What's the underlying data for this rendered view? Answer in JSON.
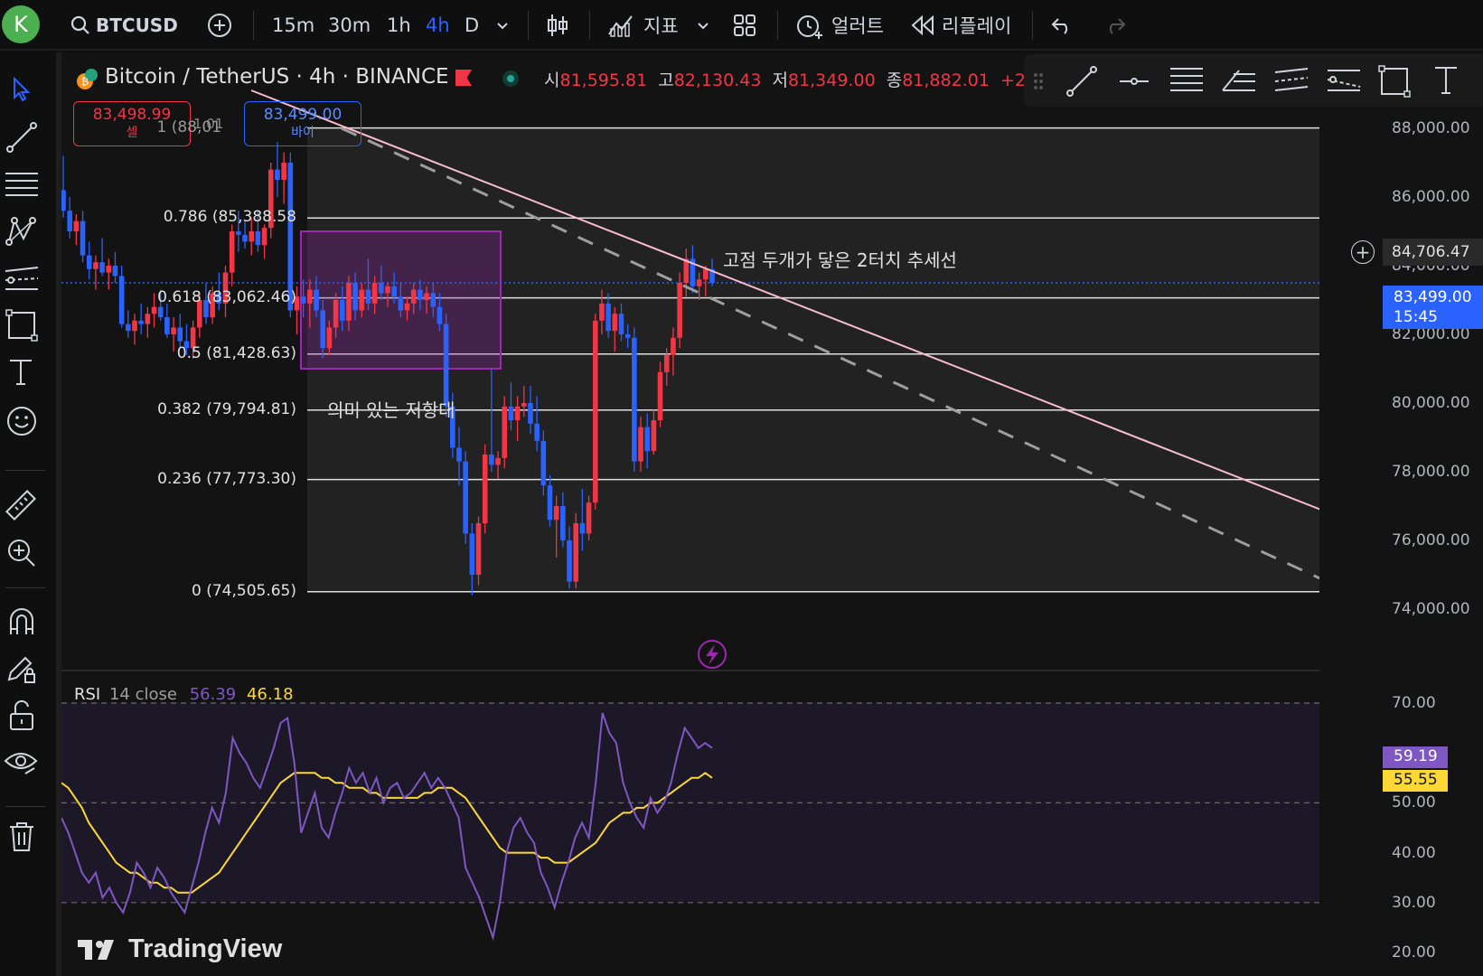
{
  "topbar": {
    "avatar": "K",
    "symbol": "BTCUSD",
    "timeframes": [
      "15m",
      "30m",
      "1h",
      "4h",
      "D"
    ],
    "active_timeframe": "4h",
    "indicators_label": "지표",
    "alert_label": "얼러트",
    "replay_label": "리플레이"
  },
  "legend": {
    "title": "Bitcoin / TetherUS · 4h · BINANCE",
    "open_label": "시",
    "open": "81,595.81",
    "high_label": "고",
    "high": "82,130.43",
    "low_label": "저",
    "low": "81,349.00",
    "close_label": "종",
    "close": "81,882.01",
    "change": "+2"
  },
  "trade": {
    "sell_price": "83,498.99",
    "sell_label": "셀",
    "buy_price": "83,499.00",
    "buy_label": "바이",
    "spread": "1.01"
  },
  "price_axis": {
    "ticks": [
      "88,000.00",
      "86,000.00",
      "84,000.00",
      "82,000.00",
      "80,000.00",
      "78,000.00",
      "76,000.00",
      "74,000.00"
    ],
    "crosshair_price": "84,706.47",
    "current_price": "83,499.00",
    "countdown": "15:45"
  },
  "fib_levels": [
    {
      "label": "1 (88,01",
      "value": 88010
    },
    {
      "label": "0.786 (85,388.58",
      "value": 85388.58
    },
    {
      "label": "0.618 (83,062.46)",
      "value": 83062.46
    },
    {
      "label": "0.5 (81,428.63)",
      "value": 81428.63
    },
    {
      "label": "0.382 (79,794.81)",
      "value": 79794.81
    },
    {
      "label": "0.236 (77,773.30)",
      "value": 77773.3
    },
    {
      "label": "0 (74,505.65)",
      "value": 74505.65
    }
  ],
  "annotations": {
    "resistance": "의미 있는 저항대",
    "trendline": "고점 두개가 닿은 2터치 추세선"
  },
  "rsi": {
    "name": "RSI",
    "params": "14 close",
    "rsi_value": "56.39",
    "ma_value": "46.18",
    "axis_ticks": [
      "70.00",
      "50.00",
      "40.00",
      "30.00",
      "20.00"
    ],
    "rsi_last": "59.19",
    "ma_last": "55.55"
  },
  "branding": "TradingView",
  "colors": {
    "up": "#f23645",
    "down": "#2962ff",
    "rsi_line": "#7e57c2",
    "rsi_ma": "#fdd835",
    "zone": "#9c27b0",
    "trendline": "#f8bbd0",
    "accent": "#2962ff"
  },
  "chart_data": {
    "type": "candlestick",
    "ylim": [
      74000,
      88600
    ],
    "candles": [
      {
        "o": 86200,
        "h": 87200,
        "l": 85400,
        "c": 85600
      },
      {
        "o": 85600,
        "h": 86000,
        "l": 84800,
        "c": 85000
      },
      {
        "o": 85000,
        "h": 85500,
        "l": 84600,
        "c": 85300
      },
      {
        "o": 85300,
        "h": 85600,
        "l": 84100,
        "c": 84300
      },
      {
        "o": 84300,
        "h": 84700,
        "l": 83600,
        "c": 83900
      },
      {
        "o": 83900,
        "h": 84300,
        "l": 83300,
        "c": 84100
      },
      {
        "o": 84100,
        "h": 84800,
        "l": 83700,
        "c": 83800
      },
      {
        "o": 83800,
        "h": 84200,
        "l": 83300,
        "c": 84000
      },
      {
        "o": 84000,
        "h": 84400,
        "l": 83500,
        "c": 83700
      },
      {
        "o": 83700,
        "h": 84000,
        "l": 82200,
        "c": 82300
      },
      {
        "o": 82300,
        "h": 82700,
        "l": 81900,
        "c": 82100
      },
      {
        "o": 82100,
        "h": 82600,
        "l": 81700,
        "c": 82400
      },
      {
        "o": 82400,
        "h": 82900,
        "l": 82000,
        "c": 82300
      },
      {
        "o": 82300,
        "h": 82800,
        "l": 81900,
        "c": 82600
      },
      {
        "o": 82600,
        "h": 83200,
        "l": 82200,
        "c": 82800
      },
      {
        "o": 82800,
        "h": 83300,
        "l": 82400,
        "c": 82500
      },
      {
        "o": 82500,
        "h": 82900,
        "l": 81900,
        "c": 82000
      },
      {
        "o": 82000,
        "h": 82500,
        "l": 81500,
        "c": 82200
      },
      {
        "o": 82200,
        "h": 82600,
        "l": 81600,
        "c": 81800
      },
      {
        "o": 81800,
        "h": 82300,
        "l": 81400,
        "c": 81600
      },
      {
        "o": 81600,
        "h": 82400,
        "l": 81300,
        "c": 82200
      },
      {
        "o": 82200,
        "h": 83200,
        "l": 81900,
        "c": 83000
      },
      {
        "o": 83000,
        "h": 83500,
        "l": 82300,
        "c": 82500
      },
      {
        "o": 82500,
        "h": 83400,
        "l": 82300,
        "c": 83200
      },
      {
        "o": 83200,
        "h": 83800,
        "l": 82700,
        "c": 82900
      },
      {
        "o": 82900,
        "h": 84000,
        "l": 82500,
        "c": 83800
      },
      {
        "o": 83800,
        "h": 85200,
        "l": 83400,
        "c": 85000
      },
      {
        "o": 85000,
        "h": 85600,
        "l": 84400,
        "c": 84900
      },
      {
        "o": 84900,
        "h": 85300,
        "l": 84500,
        "c": 84700
      },
      {
        "o": 84700,
        "h": 85400,
        "l": 84300,
        "c": 85000
      },
      {
        "o": 85000,
        "h": 85600,
        "l": 84400,
        "c": 84600
      },
      {
        "o": 84600,
        "h": 85200,
        "l": 84200,
        "c": 85100
      },
      {
        "o": 85100,
        "h": 87000,
        "l": 84800,
        "c": 86800
      },
      {
        "o": 86800,
        "h": 87600,
        "l": 86000,
        "c": 86500
      },
      {
        "o": 86500,
        "h": 87300,
        "l": 85800,
        "c": 87000
      },
      {
        "o": 87000,
        "h": 87300,
        "l": 82500,
        "c": 82700
      },
      {
        "o": 82700,
        "h": 83400,
        "l": 82000,
        "c": 83100
      },
      {
        "o": 83100,
        "h": 83600,
        "l": 82500,
        "c": 82900
      },
      {
        "o": 82900,
        "h": 83600,
        "l": 82200,
        "c": 83300
      },
      {
        "o": 83300,
        "h": 83700,
        "l": 82500,
        "c": 82700
      },
      {
        "o": 82700,
        "h": 83000,
        "l": 81300,
        "c": 81600
      },
      {
        "o": 81600,
        "h": 82400,
        "l": 81400,
        "c": 82200
      },
      {
        "o": 82200,
        "h": 83200,
        "l": 81900,
        "c": 83000
      },
      {
        "o": 83000,
        "h": 83400,
        "l": 82100,
        "c": 82400
      },
      {
        "o": 82400,
        "h": 83700,
        "l": 82100,
        "c": 83500
      },
      {
        "o": 83500,
        "h": 83800,
        "l": 82400,
        "c": 82700
      },
      {
        "o": 82700,
        "h": 83500,
        "l": 82500,
        "c": 83300
      },
      {
        "o": 83300,
        "h": 84200,
        "l": 82700,
        "c": 82900
      },
      {
        "o": 82900,
        "h": 83700,
        "l": 82600,
        "c": 83500
      },
      {
        "o": 83500,
        "h": 84000,
        "l": 83000,
        "c": 83200
      },
      {
        "o": 83200,
        "h": 83500,
        "l": 82800,
        "c": 83400
      },
      {
        "o": 83400,
        "h": 83800,
        "l": 82900,
        "c": 83100
      },
      {
        "o": 83100,
        "h": 83500,
        "l": 82500,
        "c": 82700
      },
      {
        "o": 82700,
        "h": 83100,
        "l": 82400,
        "c": 82900
      },
      {
        "o": 82900,
        "h": 83500,
        "l": 82600,
        "c": 83300
      },
      {
        "o": 83300,
        "h": 83600,
        "l": 82700,
        "c": 83000
      },
      {
        "o": 83000,
        "h": 83400,
        "l": 82600,
        "c": 83200
      },
      {
        "o": 83200,
        "h": 83500,
        "l": 82500,
        "c": 82800
      },
      {
        "o": 82800,
        "h": 83200,
        "l": 82100,
        "c": 82300
      },
      {
        "o": 82300,
        "h": 82600,
        "l": 79600,
        "c": 79900
      },
      {
        "o": 79900,
        "h": 80300,
        "l": 78400,
        "c": 78700
      },
      {
        "o": 78700,
        "h": 79300,
        "l": 77600,
        "c": 78300
      },
      {
        "o": 78300,
        "h": 78600,
        "l": 75900,
        "c": 76200
      },
      {
        "o": 76200,
        "h": 76500,
        "l": 74400,
        "c": 75000
      },
      {
        "o": 75000,
        "h": 76700,
        "l": 74700,
        "c": 76500
      },
      {
        "o": 76500,
        "h": 78800,
        "l": 76200,
        "c": 78500
      },
      {
        "o": 78500,
        "h": 81000,
        "l": 78000,
        "c": 78200
      },
      {
        "o": 78200,
        "h": 78600,
        "l": 77800,
        "c": 78400
      },
      {
        "o": 78400,
        "h": 80200,
        "l": 78100,
        "c": 79900
      },
      {
        "o": 79900,
        "h": 80600,
        "l": 79200,
        "c": 79500
      },
      {
        "o": 79500,
        "h": 80200,
        "l": 78900,
        "c": 79900
      },
      {
        "o": 79900,
        "h": 80500,
        "l": 79600,
        "c": 80000
      },
      {
        "o": 80000,
        "h": 80500,
        "l": 79100,
        "c": 79400
      },
      {
        "o": 79400,
        "h": 80200,
        "l": 78600,
        "c": 78900
      },
      {
        "o": 78900,
        "h": 79200,
        "l": 77300,
        "c": 77600
      },
      {
        "o": 77600,
        "h": 77900,
        "l": 76400,
        "c": 76600
      },
      {
        "o": 76600,
        "h": 77300,
        "l": 75500,
        "c": 77000
      },
      {
        "o": 77000,
        "h": 77400,
        "l": 75800,
        "c": 76000
      },
      {
        "o": 76000,
        "h": 76400,
        "l": 74600,
        "c": 74800
      },
      {
        "o": 74800,
        "h": 76800,
        "l": 74600,
        "c": 76500
      },
      {
        "o": 76500,
        "h": 77500,
        "l": 75700,
        "c": 76200
      },
      {
        "o": 76200,
        "h": 77300,
        "l": 76000,
        "c": 77100
      },
      {
        "o": 77100,
        "h": 82600,
        "l": 76900,
        "c": 82400
      },
      {
        "o": 82400,
        "h": 83300,
        "l": 82000,
        "c": 82900
      },
      {
        "o": 82900,
        "h": 83200,
        "l": 81900,
        "c": 82100
      },
      {
        "o": 82100,
        "h": 82800,
        "l": 81500,
        "c": 82600
      },
      {
        "o": 82600,
        "h": 82900,
        "l": 81800,
        "c": 82000
      },
      {
        "o": 82000,
        "h": 82300,
        "l": 81600,
        "c": 81900
      },
      {
        "o": 81900,
        "h": 82200,
        "l": 78000,
        "c": 78300
      },
      {
        "o": 78300,
        "h": 79600,
        "l": 78000,
        "c": 79300
      },
      {
        "o": 79300,
        "h": 79700,
        "l": 78100,
        "c": 78600
      },
      {
        "o": 78600,
        "h": 79800,
        "l": 78500,
        "c": 79500
      },
      {
        "o": 79500,
        "h": 81200,
        "l": 79300,
        "c": 80900
      },
      {
        "o": 80900,
        "h": 81600,
        "l": 80500,
        "c": 81400
      },
      {
        "o": 81400,
        "h": 82200,
        "l": 80800,
        "c": 81900
      },
      {
        "o": 81900,
        "h": 83800,
        "l": 81600,
        "c": 83500
      },
      {
        "o": 83500,
        "h": 84500,
        "l": 83100,
        "c": 84200
      },
      {
        "o": 84200,
        "h": 84600,
        "l": 83200,
        "c": 83400
      },
      {
        "o": 83400,
        "h": 83800,
        "l": 83000,
        "c": 83600
      },
      {
        "o": 83600,
        "h": 84000,
        "l": 83100,
        "c": 83900
      },
      {
        "o": 83900,
        "h": 84200,
        "l": 83400,
        "c": 83500
      }
    ],
    "rsi": [
      47,
      44,
      40,
      36,
      34,
      36,
      31,
      33,
      30,
      28,
      32,
      38,
      36,
      33,
      37,
      35,
      32,
      30,
      28,
      33,
      38,
      44,
      49,
      46,
      52,
      63,
      60,
      58,
      55,
      53,
      57,
      61,
      66,
      67,
      58,
      44,
      48,
      52,
      45,
      43,
      48,
      52,
      57,
      54,
      56,
      52,
      55,
      50,
      53,
      54,
      51,
      52,
      54,
      56,
      53,
      55,
      53,
      50,
      47,
      37,
      34,
      31,
      27,
      23,
      30,
      40,
      45,
      47,
      44,
      42,
      36,
      33,
      29,
      34,
      38,
      43,
      46,
      43,
      54,
      68,
      64,
      62,
      54,
      50,
      47,
      45,
      51,
      48,
      50,
      54,
      60,
      65,
      63,
      61,
      62,
      61
    ],
    "rsi_ma": [
      54,
      53,
      51,
      49,
      46,
      44,
      42,
      40,
      38,
      37,
      36,
      36,
      35,
      34,
      34,
      33,
      33,
      32,
      32,
      32,
      33,
      34,
      35,
      36,
      38,
      40,
      42,
      44,
      46,
      48,
      50,
      52,
      54,
      55,
      56,
      56,
      56,
      56,
      55,
      55,
      54,
      54,
      53,
      53,
      53,
      52,
      52,
      51,
      51,
      51,
      51,
      51,
      51,
      52,
      52,
      53,
      53,
      53,
      52,
      51,
      49,
      47,
      45,
      43,
      41,
      40,
      40,
      40,
      40,
      40,
      39,
      39,
      38,
      38,
      38,
      39,
      40,
      41,
      42,
      44,
      46,
      47,
      48,
      48,
      49,
      49,
      50,
      50,
      51,
      52,
      53,
      54,
      55,
      55,
      56,
      55
    ],
    "rsi_ylim": [
      19,
      71
    ]
  }
}
